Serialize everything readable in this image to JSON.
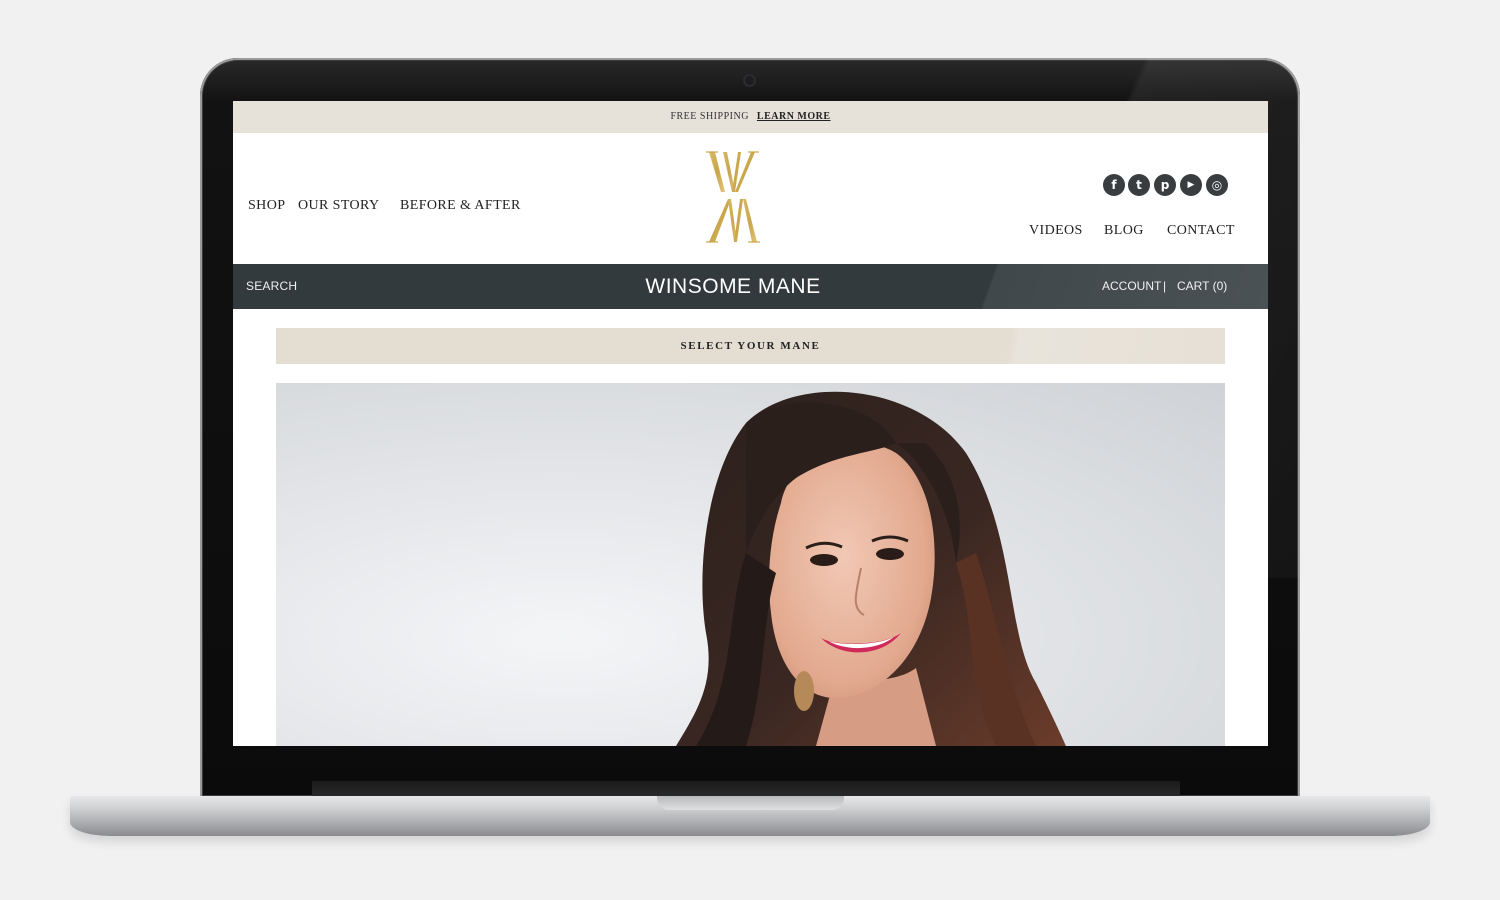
{
  "promo": {
    "text": "FREE SHIPPING",
    "link": "LEARN MORE"
  },
  "nav": {
    "left": [
      "SHOP",
      "OUR STORY",
      "BEFORE & AFTER"
    ],
    "right": [
      "VIDEOS",
      "BLOG",
      "CONTACT"
    ]
  },
  "logo_icon": "wm-monogram-logo",
  "social": [
    {
      "icon": "facebook-icon",
      "glyph": "f"
    },
    {
      "icon": "twitter-icon",
      "glyph": "t"
    },
    {
      "icon": "pinterest-icon",
      "glyph": "p"
    },
    {
      "icon": "youtube-icon",
      "glyph": "▶"
    },
    {
      "icon": "instagram-icon",
      "glyph": "◎"
    }
  ],
  "bar": {
    "search": "SEARCH",
    "brand": "WINSOME MANE",
    "account": "ACCOUNT",
    "separator": "|",
    "cart": "CART (0)"
  },
  "select_label": "SELECT YOUR MANE",
  "colors": {
    "promo_bg": "#e6e1d9",
    "bar_bg": "#323a3e",
    "gold": "#c9a64a",
    "select_bg": "#e3ddd2"
  }
}
